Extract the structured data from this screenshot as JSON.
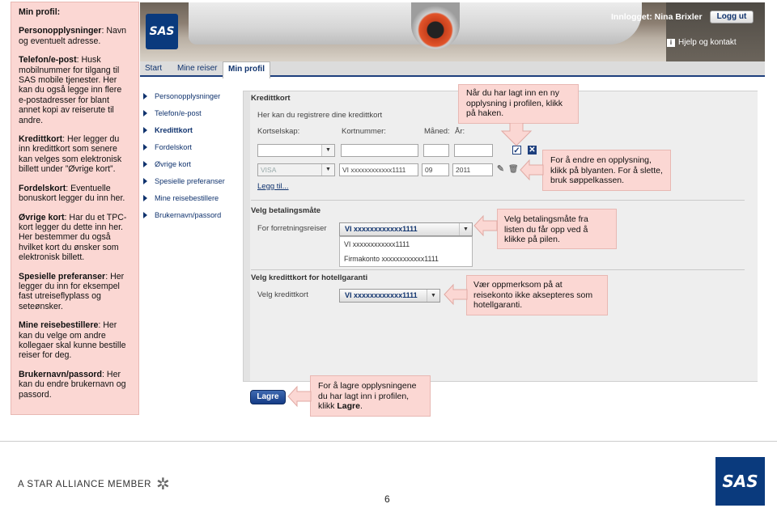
{
  "help_panel": {
    "title": "Min profil:",
    "paragraphs": [
      {
        "term": "Personopplysninger",
        "text": ": Navn og eventuelt adresse."
      },
      {
        "term": "Telefon/e-post",
        "text": ": Husk mobilnummer for tilgang til SAS mobile tjenester. Her kan du også legge inn flere e-postadresser for blant annet kopi av reiserute til andre."
      },
      {
        "term": "Kredittkort",
        "text": ": Her legger du inn kredittkort som senere kan velges som elektronisk billett under ”Øvrige kort”."
      },
      {
        "term": "Fordelskort",
        "text": ": Eventuelle bonuskort legger du inn her."
      },
      {
        "term": "Øvrige kort",
        "text": ": Har du et TPC-kort legger du dette inn her. Her bestemmer du også hvilket kort du ønsker som elektronisk billett."
      },
      {
        "term": "Spesielle preferanser",
        "text": ": Her legger du inn for eksempel fast utreiseflyplass og seteønsker."
      },
      {
        "term": "Mine reisebestillere",
        "text": ": Her kan du velge om andre kollegaer skal kunne bestille reiser for deg."
      },
      {
        "term": "Brukernavn/passord",
        "text": ": Her kan du endre brukernavn og passord."
      }
    ]
  },
  "header": {
    "logo_text": "SAS",
    "logged_in": "Innlogget: Nina Brixler",
    "logout_label": "Logg ut",
    "help_label": "Hjelp og kontakt"
  },
  "tabs": [
    {
      "label": "Start",
      "active": false
    },
    {
      "label": "Mine reiser",
      "active": false
    },
    {
      "label": "Min profil",
      "active": true
    }
  ],
  "side_nav": [
    {
      "label": "Personopplysninger",
      "bold": false
    },
    {
      "label": "Telefon/e-post",
      "bold": false
    },
    {
      "label": "Kredittkort",
      "bold": true
    },
    {
      "label": "Fordelskort",
      "bold": false
    },
    {
      "label": "Øvrige kort",
      "bold": false
    },
    {
      "label": "Spesielle preferanser",
      "bold": false
    },
    {
      "label": "Mine reisebestillere",
      "bold": false
    },
    {
      "label": "Brukernavn/passord",
      "bold": false
    }
  ],
  "credit_card": {
    "title": "Kredittkort",
    "intro": "Her kan du registrere dine kredittkort",
    "col_company": "Kortselskap:",
    "col_number": "Kortnummer:",
    "col_month": "Måned:",
    "col_year": "År:",
    "saved_company": "VISA",
    "saved_number": "VI xxxxxxxxxxxx1111",
    "saved_month": "09",
    "saved_year": "2011",
    "add_link": "Legg til..."
  },
  "payment": {
    "title": "Velg betalingsmåte",
    "label": "For forretningsreiser",
    "selected": "VI xxxxxxxxxxxx1111",
    "options": [
      "VI xxxxxxxxxxxx1111",
      "Firmakonto xxxxxxxxxxxx1111"
    ]
  },
  "hotel": {
    "title": "Velg kredittkort for hotellgaranti",
    "label": "Velg kredittkort",
    "selected": "VI xxxxxxxxxxxx1111"
  },
  "save_label": "Lagre",
  "callouts": {
    "new_info": "Når du har lagt inn en ny opplysning i profilen, klikk på haken.",
    "change_info": "For å endre en opplysning, klikk på blyanten. For å slette, bruk søppelkassen.",
    "payment_info": "Velg betalingsmåte fra listen du får opp ved å klikke på pilen.",
    "hotel_info": "Vær oppmerksom på at reisekonto ikke aksepteres som hotellgaranti.",
    "save_info_pre": "For å lagre opplysningene du har lagt inn i profilen, klikk ",
    "save_info_bold": "Lagre",
    "save_info_post": "."
  },
  "footer": {
    "star_alliance": "A STAR ALLIANCE MEMBER",
    "page_number": "6",
    "logo_text": "SAS"
  },
  "colors": {
    "callout_bg": "#fbd7d3",
    "brand_blue": "#0a3a7d",
    "nav_blue": "#10336e"
  }
}
